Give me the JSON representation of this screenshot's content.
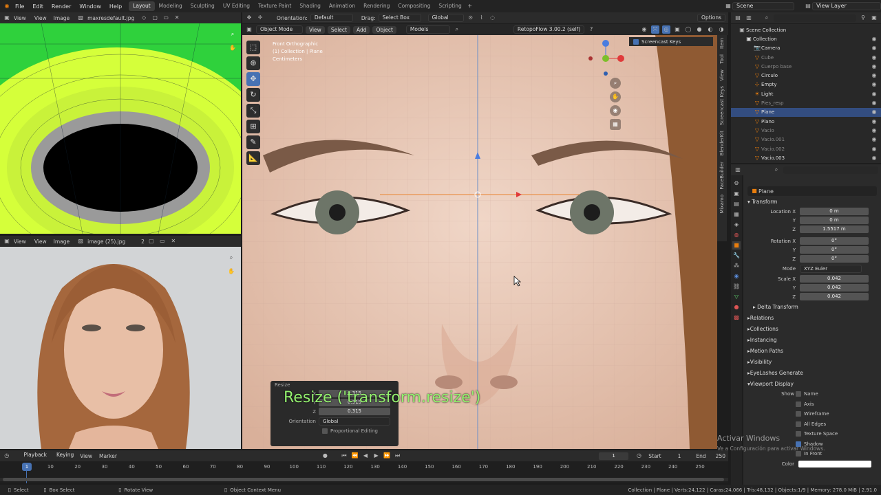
{
  "topbar": {
    "menus": [
      "File",
      "Edit",
      "Render",
      "Window",
      "Help"
    ],
    "workspaces": [
      "Layout",
      "Modeling",
      "Sculpting",
      "UV Editing",
      "Texture Paint",
      "Shading",
      "Animation",
      "Rendering",
      "Compositing",
      "Scripting"
    ],
    "active_workspace": "Layout",
    "scene": "Scene",
    "view_layer": "View Layer"
  },
  "image_editor_top": {
    "menus": [
      "View",
      "View",
      "Image"
    ],
    "image_name": "maxresdefault.jpg"
  },
  "image_editor_bottom": {
    "menus": [
      "View",
      "View",
      "Image"
    ],
    "image_name": "image (25).jpg",
    "users": "2"
  },
  "viewport_header": {
    "orientation_label": "Orientation:",
    "orientation_value": "Default",
    "drag_label": "Drag:",
    "drag_value": "Select Box",
    "transform_orientation": "Global",
    "options": "Options"
  },
  "viewport_header2": {
    "mode": "Object Mode",
    "menus": [
      "View",
      "Select",
      "Add",
      "Object"
    ],
    "models": "Models",
    "addon": "RetopoFlow 3.00.2 (self)"
  },
  "viewport_overlay": {
    "line1": "Front Orthographic",
    "line2": "(1) Collection | Plane",
    "line3": "Centimeters"
  },
  "screencast": "Screencast Keys",
  "side_tabs": [
    "Item",
    "Tool",
    "View",
    "Screencast Keys",
    "BlenderKit",
    "FaceBuilder",
    "Mixamo"
  ],
  "resize_panel": {
    "title": "Resize",
    "big_text": "Resize ('transform.resize')",
    "x": "0.315",
    "y": "0.315",
    "z": "0.315",
    "orientation_label": "Orientation",
    "orientation": "Global",
    "prop_editing": "Proportional Editing"
  },
  "outliner": {
    "root": "Scene Collection",
    "items": [
      {
        "name": "Collection",
        "dim": false,
        "sel": false
      },
      {
        "name": "Camera",
        "dim": false,
        "sel": false
      },
      {
        "name": "Cube",
        "dim": true,
        "sel": false
      },
      {
        "name": "Cuerpo base",
        "dim": true,
        "sel": false
      },
      {
        "name": "Circulo",
        "dim": false,
        "sel": false
      },
      {
        "name": "Empty",
        "dim": false,
        "sel": false
      },
      {
        "name": "Light",
        "dim": false,
        "sel": false
      },
      {
        "name": "Pies_resp",
        "dim": true,
        "sel": false
      },
      {
        "name": "Plane",
        "dim": false,
        "sel": true
      },
      {
        "name": "Plano",
        "dim": false,
        "sel": false
      },
      {
        "name": "Vacio",
        "dim": true,
        "sel": false
      },
      {
        "name": "Vacio.001",
        "dim": true,
        "sel": false
      },
      {
        "name": "Vacio.002",
        "dim": true,
        "sel": false
      },
      {
        "name": "Vacio.003",
        "dim": false,
        "sel": false
      }
    ]
  },
  "properties": {
    "object_name": "Plane",
    "transform": "Transform",
    "location": {
      "label": "Location X",
      "x": "0 m",
      "y": "0 m",
      "z": "1.5517 m"
    },
    "rotation": {
      "label": "Rotation X",
      "x": "0°",
      "y": "0°",
      "z": "0°"
    },
    "mode_label": "Mode",
    "mode": "XYZ Euler",
    "scale": {
      "label": "Scale X",
      "x": "0.042",
      "y": "0.042",
      "z": "0.042"
    },
    "axis_y": "Y",
    "axis_z": "Z",
    "delta": "Delta Transform",
    "sections": [
      "Relations",
      "Collections",
      "Instancing",
      "Motion Paths",
      "Visibility",
      "EyeLashes Generate",
      "Viewport Display"
    ],
    "show_label": "Show",
    "show_items": [
      {
        "label": "Name",
        "on": false
      },
      {
        "label": "Axis",
        "on": false
      },
      {
        "label": "Wireframe",
        "on": false
      },
      {
        "label": "All Edges",
        "on": false
      },
      {
        "label": "Texture Space",
        "on": false
      },
      {
        "label": "Shadow",
        "on": true
      },
      {
        "label": "In Front",
        "on": false
      }
    ],
    "color_label": "Color"
  },
  "watermark": {
    "line1": "Activar Windows",
    "line2": "Ve a Configuración para activar Windows."
  },
  "timeline": {
    "menus": [
      "Playback",
      "Keying",
      "View",
      "Marker"
    ],
    "current": "1",
    "start_label": "Start",
    "start": "1",
    "end_label": "End",
    "end": "250",
    "ticks": [
      "10",
      "20",
      "30",
      "40",
      "50",
      "60",
      "70",
      "80",
      "90",
      "100",
      "110",
      "120",
      "130",
      "140",
      "150",
      "160",
      "170",
      "180",
      "190",
      "200",
      "210",
      "220",
      "230",
      "240",
      "250"
    ],
    "playhead": "1"
  },
  "statusbar": {
    "select": "Select",
    "box_select": "Box Select",
    "rotate_view": "Rotate View",
    "context_menu": "Object Context Menu",
    "stats": "Collection | Plane | Verts:24,122 | Caras:24,066 | Tris:48,132 | Objects:1/9 | Memory: 278.0 MiB | 2.91.0"
  }
}
